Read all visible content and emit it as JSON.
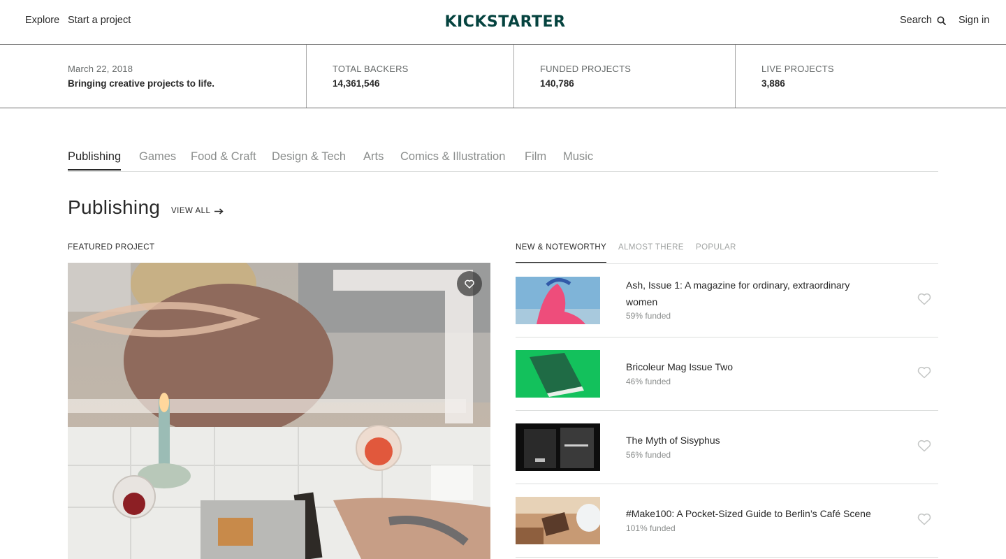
{
  "header": {
    "explore": "Explore",
    "start_project": "Start a project",
    "logo_text": "KICKSTARTER",
    "search": "Search",
    "sign_in": "Sign in"
  },
  "stats": {
    "date": "March 22, 2018",
    "tagline": "Bringing creative projects to life.",
    "backers_label": "TOTAL BACKERS",
    "backers_value": "14,361,546",
    "funded_label": "FUNDED PROJECTS",
    "funded_value": "140,786",
    "live_label": "LIVE PROJECTS",
    "live_value": "3,886"
  },
  "categories": [
    "Publishing",
    "Games",
    "Food & Craft",
    "Design & Tech",
    "Arts",
    "Comics & Illustration",
    "Film",
    "Music"
  ],
  "section": {
    "title": "Publishing",
    "view_all": "VIEW ALL"
  },
  "featured": {
    "label": "FEATURED PROJECT"
  },
  "list_tabs": [
    "NEW & NOTEWORTHY",
    "ALMOST THERE",
    "POPULAR"
  ],
  "projects": [
    {
      "title": "Ash, Issue 1: A magazine for ordinary, extraordinary women",
      "funded": "59% funded"
    },
    {
      "title": "Bricoleur Mag Issue Two",
      "funded": "46% funded"
    },
    {
      "title": "The Myth of Sisyphus",
      "funded": "56% funded"
    },
    {
      "title": "#Make100: A Pocket-Sized Guide to Berlin’s Café Scene",
      "funded": "101% funded"
    }
  ],
  "colors": {
    "brand": "#05433f",
    "text": "#282828",
    "muted": "#8a8d8c"
  }
}
